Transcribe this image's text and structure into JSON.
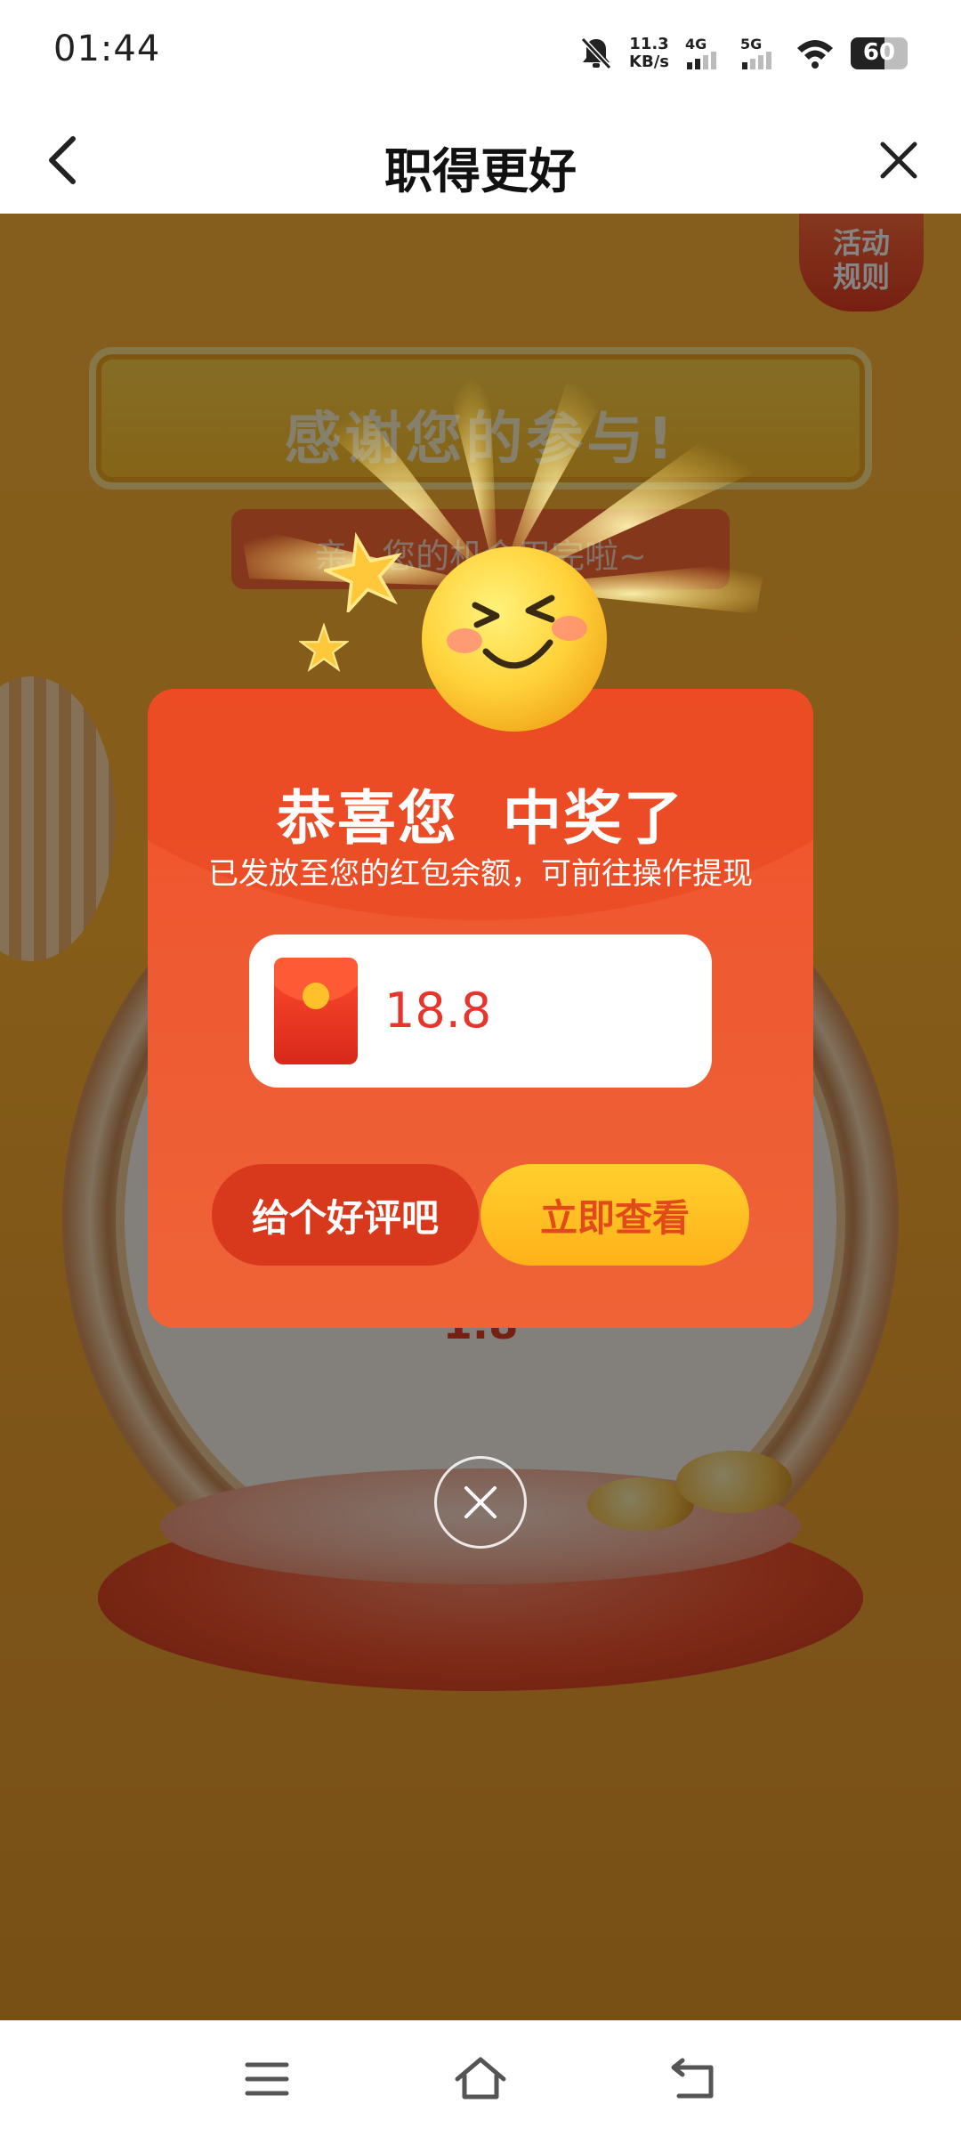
{
  "status_bar": {
    "time": "01:44",
    "net_speed_value": "11.3",
    "net_speed_unit": "KB/s",
    "signal_1": "4G",
    "signal_2": "5G",
    "battery": "60",
    "battery_level": 0.6
  },
  "header": {
    "title": "职得更好",
    "back_icon": "back-arrow-icon",
    "close_icon": "close-icon"
  },
  "activity": {
    "rules_badge": "活动\n规则",
    "thanks_title": "感谢您的参与!",
    "subtitle": "亲，您的机会用完啦~",
    "wheel_value": "1.8"
  },
  "modal": {
    "title": "恭喜您  中奖了",
    "subtitle": "已发放至您的红包余额，可前往操作提现",
    "prize_amount": "18.8",
    "review_button": "给个好评吧",
    "view_button": "立即查看",
    "emoji": "smiling-face-icon",
    "close_icon": "close-circle-icon"
  },
  "nav_bar": {
    "menu_icon": "menu-icon",
    "home_icon": "home-icon",
    "back_icon": "back-icon"
  },
  "colors": {
    "modal_bg": "#ef5a32",
    "view_button_bg": "#ffbf22",
    "review_button_bg": "#d8391c",
    "prize_amount": "#e8352b",
    "activity_bg": "#ffb02e"
  }
}
